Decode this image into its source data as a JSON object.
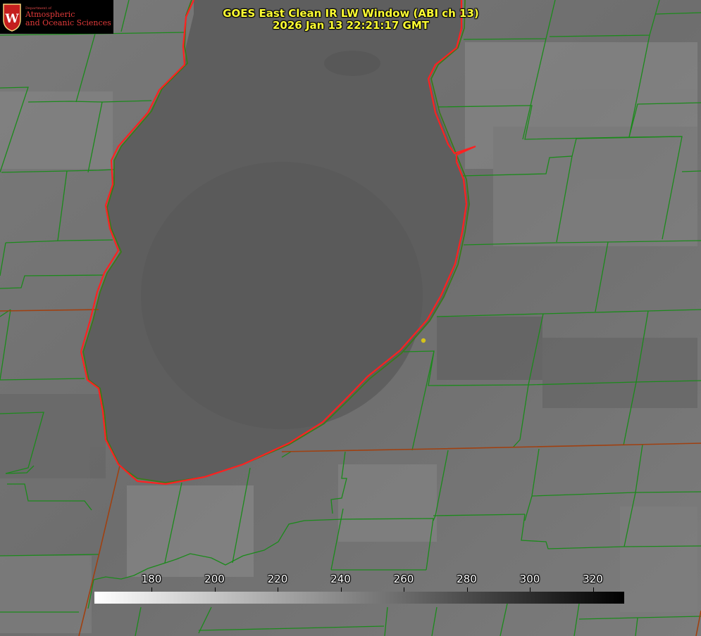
{
  "logo": {
    "department": "Department of",
    "line1": "Atmospheric",
    "line2": "and Oceanic Sciences",
    "seal_letter": "W"
  },
  "title": {
    "line1": "GOES East Clean IR LW Window (ABI ch 13)",
    "line2": "2026 Jan 13 22:21:17 GMT"
  },
  "colorbar": {
    "ticks": [
      "180",
      "200",
      "220",
      "240",
      "260",
      "280",
      "300",
      "320"
    ],
    "gradient_start": "#ffffff",
    "gradient_end": "#000000"
  },
  "colors": {
    "lake_outline": "#ff2020",
    "county_lines": "#1b8a1b",
    "state_lines": "#a04010",
    "marker": "#d4c21a",
    "title_text": "#ffff33"
  },
  "icons": {
    "seal": "uw-crest-icon",
    "marker": "location-dot-icon"
  }
}
